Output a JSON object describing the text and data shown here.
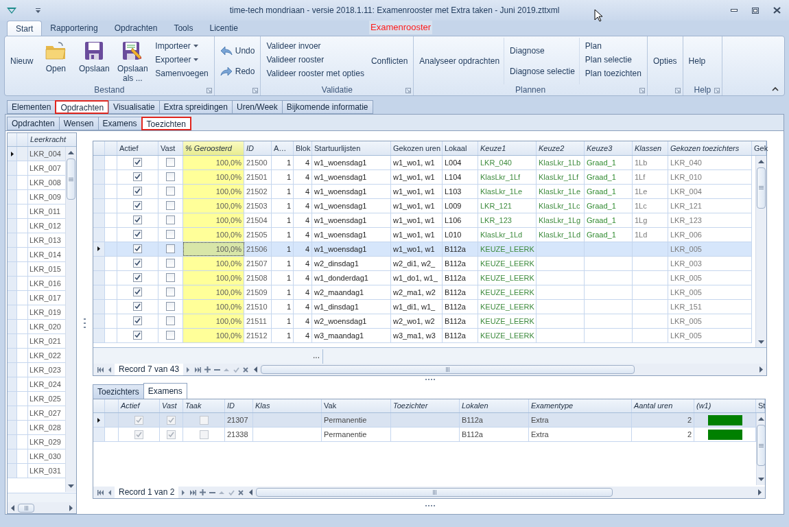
{
  "window": {
    "title": "time-tech mondriaan - versie 2018.1.11: Examenrooster met Extra taken - Juni 2019.zttxml"
  },
  "ribbon_tabs": [
    {
      "label": "Start",
      "selected": true
    },
    {
      "label": "Rapportering",
      "selected": false
    },
    {
      "label": "Opdrachten",
      "selected": false
    },
    {
      "label": "Tools",
      "selected": false
    },
    {
      "label": "Licentie",
      "selected": false
    }
  ],
  "context_label": "Examenrooster",
  "ribbon_groups": [
    {
      "label": "Bestand",
      "columns": [
        [
          {
            "label": "Nieuw",
            "kind": "plain"
          }
        ],
        [
          {
            "label": "Open",
            "kind": "folder"
          }
        ],
        [
          {
            "label": "Opslaan",
            "kind": "disk"
          }
        ],
        [
          {
            "label": "Opslaan als ...",
            "kind": "diskedit"
          }
        ],
        [
          {
            "label": "Importeer",
            "kind": "dropdown"
          },
          {
            "label": "Exporteer",
            "kind": "dropdown"
          },
          {
            "label": "Samenvoegen",
            "kind": "text"
          }
        ]
      ]
    },
    {
      "columns": [
        [
          {
            "label": "Undo",
            "kind": "undo"
          },
          {
            "label": "Redo",
            "kind": "redo"
          }
        ]
      ]
    },
    {
      "label": "Validatie",
      "columns": [
        [
          {
            "label": "Valideer invoer",
            "kind": "text"
          },
          {
            "label": "Valideer rooster",
            "kind": "text"
          },
          {
            "label": "Valideer rooster met opties",
            "kind": "text"
          }
        ],
        [
          {
            "label": "Conflicten",
            "kind": "text"
          }
        ]
      ]
    },
    {
      "label": "Plannen",
      "columns": [
        [
          {
            "label": "Analyseer opdrachten",
            "kind": "text"
          }
        ],
        [
          {
            "label": "Diagnose",
            "kind": "text"
          },
          {
            "label": "Diagnose selectie",
            "kind": "text"
          }
        ],
        [
          {
            "label": "Plan",
            "kind": "text"
          },
          {
            "label": "Plan selectie",
            "kind": "text"
          },
          {
            "label": "Plan toezichten",
            "kind": "text"
          }
        ]
      ]
    },
    {
      "columns": [
        [
          {
            "label": "Opties",
            "kind": "text"
          }
        ]
      ]
    },
    {
      "label": "Help",
      "columns": [
        [
          {
            "label": "Help",
            "kind": "text"
          }
        ]
      ]
    }
  ],
  "element_tabs": [
    {
      "label": "Elementen",
      "selected": false
    },
    {
      "label": "Opdrachten",
      "selected": true
    },
    {
      "label": "Visualisatie",
      "selected": false
    },
    {
      "label": "Extra spreidingen",
      "selected": false
    },
    {
      "label": "Uren/Week",
      "selected": false
    },
    {
      "label": "Bijkomende informatie",
      "selected": false
    }
  ],
  "sub_tabs": [
    {
      "label": "Opdrachten",
      "selected": false
    },
    {
      "label": "Wensen",
      "selected": false
    },
    {
      "label": "Examens",
      "selected": false
    },
    {
      "label": "Toezichten",
      "selected": true
    }
  ],
  "teacher_list": {
    "header": "Leerkracht",
    "rows": [
      {
        "label": "LKR_004",
        "selected": true
      },
      {
        "label": "LKR_007",
        "selected": false
      },
      {
        "label": "LKR_008",
        "selected": false
      },
      {
        "label": "LKR_009",
        "selected": false
      },
      {
        "label": "LKR_011",
        "selected": false
      },
      {
        "label": "LKR_012",
        "selected": false
      },
      {
        "label": "LKR_013",
        "selected": false
      },
      {
        "label": "LKR_014",
        "selected": false
      },
      {
        "label": "LKR_015",
        "selected": false
      },
      {
        "label": "LKR_016",
        "selected": false
      },
      {
        "label": "LKR_017",
        "selected": false
      },
      {
        "label": "LKR_019",
        "selected": false
      },
      {
        "label": "LKR_020",
        "selected": false
      },
      {
        "label": "LKR_021",
        "selected": false
      },
      {
        "label": "LKR_022",
        "selected": false
      },
      {
        "label": "LKR_023",
        "selected": false
      },
      {
        "label": "LKR_024",
        "selected": false
      },
      {
        "label": "LKR_025",
        "selected": false
      },
      {
        "label": "LKR_027",
        "selected": false
      },
      {
        "label": "LKR_028",
        "selected": false
      },
      {
        "label": "LKR_029",
        "selected": false
      },
      {
        "label": "LKR_030",
        "selected": false
      },
      {
        "label": "LKR_031",
        "selected": false
      }
    ]
  },
  "assignments_table": {
    "columns": [
      {
        "label": "Actief",
        "italic": false,
        "highlight": false
      },
      {
        "label": "Vast",
        "italic": false,
        "highlight": false
      },
      {
        "label": "% Geroosterd",
        "italic": true,
        "highlight": true
      },
      {
        "label": "ID",
        "italic": true,
        "highlight": false
      },
      {
        "label": "A…",
        "italic": false,
        "highlight": false
      },
      {
        "label": "Blok",
        "italic": false,
        "highlight": false
      },
      {
        "label": "Startuurlijsten",
        "italic": false,
        "highlight": false
      },
      {
        "label": "Gekozen uren",
        "italic": false,
        "highlight": false
      },
      {
        "label": "Lokaal",
        "italic": false,
        "highlight": false
      },
      {
        "label": "Keuze1",
        "italic": true,
        "highlight": false
      },
      {
        "label": "Keuze2",
        "italic": true,
        "highlight": false
      },
      {
        "label": "Keuze3",
        "italic": true,
        "highlight": false
      },
      {
        "label": "Klassen",
        "italic": true,
        "highlight": false
      },
      {
        "label": "Gekozen toezichters",
        "italic": true,
        "highlight": false
      },
      {
        "label": "Gek",
        "italic": false,
        "highlight": false
      }
    ],
    "rows": [
      {
        "selected": false,
        "actief": true,
        "vast": false,
        "pct": "100,0%",
        "id": "21500",
        "a": "1",
        "blok": "4",
        "start": "w1_woensdag1",
        "uren": "w1_wo1, w1",
        "lokaal": "L004",
        "keuze1": "LKR_040",
        "keuze2": "KlasLkr_1Lb",
        "keuze3": "Graad_1",
        "klassen": "1Lb",
        "toezichters": "LKR_040"
      },
      {
        "selected": false,
        "actief": true,
        "vast": false,
        "pct": "100,0%",
        "id": "21501",
        "a": "1",
        "blok": "4",
        "start": "w1_woensdag1",
        "uren": "w1_wo1, w1",
        "lokaal": "L104",
        "keuze1": "KlasLkr_1Lf",
        "keuze2": "KlasLkr_1Lf",
        "keuze3": "Graad_1",
        "klassen": "1Lf",
        "toezichters": "LKR_010"
      },
      {
        "selected": false,
        "actief": true,
        "vast": false,
        "pct": "100,0%",
        "id": "21502",
        "a": "1",
        "blok": "4",
        "start": "w1_woensdag1",
        "uren": "w1_wo1, w1",
        "lokaal": "L103",
        "keuze1": "KlasLkr_1Le",
        "keuze2": "KlasLkr_1Le",
        "keuze3": "Graad_1",
        "klassen": "1Le",
        "toezichters": "LKR_004"
      },
      {
        "selected": false,
        "actief": true,
        "vast": false,
        "pct": "100,0%",
        "id": "21503",
        "a": "1",
        "blok": "4",
        "start": "w1_woensdag1",
        "uren": "w1_wo1, w1",
        "lokaal": "L009",
        "keuze1": "LKR_121",
        "keuze2": "KlasLkr_1Lc",
        "keuze3": "Graad_1",
        "klassen": "1Lc",
        "toezichters": "LKR_121"
      },
      {
        "selected": false,
        "actief": true,
        "vast": false,
        "pct": "100,0%",
        "id": "21504",
        "a": "1",
        "blok": "4",
        "start": "w1_woensdag1",
        "uren": "w1_wo1, w1",
        "lokaal": "L106",
        "keuze1": "LKR_123",
        "keuze2": "KlasLkr_1Lg",
        "keuze3": "Graad_1",
        "klassen": "1Lg",
        "toezichters": "LKR_123"
      },
      {
        "selected": false,
        "actief": true,
        "vast": false,
        "pct": "100,0%",
        "id": "21505",
        "a": "1",
        "blok": "4",
        "start": "w1_woensdag1",
        "uren": "w1_wo1, w1",
        "lokaal": "L010",
        "keuze1": "KlasLkr_1Ld",
        "keuze2": "KlasLkr_1Ld",
        "keuze3": "Graad_1",
        "klassen": "1Ld",
        "toezichters": "LKR_006"
      },
      {
        "selected": true,
        "actief": true,
        "vast": false,
        "pct": "100,0%",
        "id": "21506",
        "a": "1",
        "blok": "4",
        "start": "w1_woensdag1",
        "uren": "w1_wo1, w1",
        "lokaal": "B112a",
        "keuze1": "KEUZE_LEERK",
        "toezichters": "LKR_005"
      },
      {
        "selected": false,
        "actief": true,
        "vast": false,
        "pct": "100,0%",
        "id": "21507",
        "a": "1",
        "blok": "4",
        "start": "w2_dinsdag1",
        "uren": "w2_di1, w2_",
        "lokaal": "B112a",
        "keuze1": "KEUZE_LEERK",
        "toezichters": "LKR_003"
      },
      {
        "selected": false,
        "actief": true,
        "vast": false,
        "pct": "100,0%",
        "id": "21508",
        "a": "1",
        "blok": "4",
        "start": "w1_donderdag1",
        "uren": "w1_do1, w1_",
        "lokaal": "B112a",
        "keuze1": "KEUZE_LEERK",
        "toezichters": "LKR_005"
      },
      {
        "selected": false,
        "actief": true,
        "vast": false,
        "pct": "100,0%",
        "id": "21509",
        "a": "1",
        "blok": "4",
        "start": "w2_maandag1",
        "uren": "w2_ma1, w2",
        "lokaal": "B112a",
        "keuze1": "KEUZE_LEERK",
        "toezichters": "LKR_005"
      },
      {
        "selected": false,
        "actief": true,
        "vast": false,
        "pct": "100,0%",
        "id": "21510",
        "a": "1",
        "blok": "4",
        "start": "w1_dinsdag1",
        "uren": "w1_di1, w1_",
        "lokaal": "B112a",
        "keuze1": "KEUZE_LEERK",
        "toezichters": "LKR_151"
      },
      {
        "selected": false,
        "actief": true,
        "vast": false,
        "pct": "100,0%",
        "id": "21511",
        "a": "1",
        "blok": "4",
        "start": "w2_woensdag1",
        "uren": "w2_wo1, w2",
        "lokaal": "B112a",
        "keuze1": "KEUZE_LEERK",
        "toezichters": "LKR_005"
      },
      {
        "selected": false,
        "actief": true,
        "vast": false,
        "pct": "100,0%",
        "id": "21512",
        "a": "1",
        "blok": "4",
        "start": "w3_maandag1",
        "uren": "w3_ma1, w3",
        "lokaal": "B112a",
        "keuze1": "KEUZE_LEERK",
        "toezichters": "LKR_005"
      }
    ],
    "footer_text": "...",
    "record": "Record 7 van 43"
  },
  "bottom_tabs": [
    {
      "label": "Toezichters",
      "selected": false
    },
    {
      "label": "Examens",
      "selected": true
    }
  ],
  "exams_table": {
    "columns": [
      {
        "label": "Actief",
        "italic": true
      },
      {
        "label": "Vast",
        "italic": true
      },
      {
        "label": "Taak",
        "italic": true
      },
      {
        "label": "ID",
        "italic": true
      },
      {
        "label": "Klas",
        "italic": true
      },
      {
        "label": "Vak",
        "italic": false
      },
      {
        "label": "Toezichter",
        "italic": true
      },
      {
        "label": "Lokalen",
        "italic": true
      },
      {
        "label": "Examentype",
        "italic": true
      },
      {
        "label": "Aantal uren",
        "italic": true
      },
      {
        "label": "(w1)",
        "italic": true
      },
      {
        "label": "St",
        "italic": false
      }
    ],
    "rows": [
      {
        "selected": true,
        "actief": true,
        "vast": true,
        "taak": false,
        "id": "21307",
        "vak": "Permanentie",
        "lokalen": "B112a",
        "examentype": "Extra",
        "aantal_uren": "2",
        "color": "#008000"
      },
      {
        "selected": false,
        "actief": true,
        "vast": true,
        "taak": false,
        "id": "21338",
        "vak": "Permanentie",
        "lokalen": "B112a",
        "examentype": "Extra",
        "aantal_uren": "2",
        "color": "#008000"
      }
    ],
    "record": "Record 1 van 2"
  }
}
